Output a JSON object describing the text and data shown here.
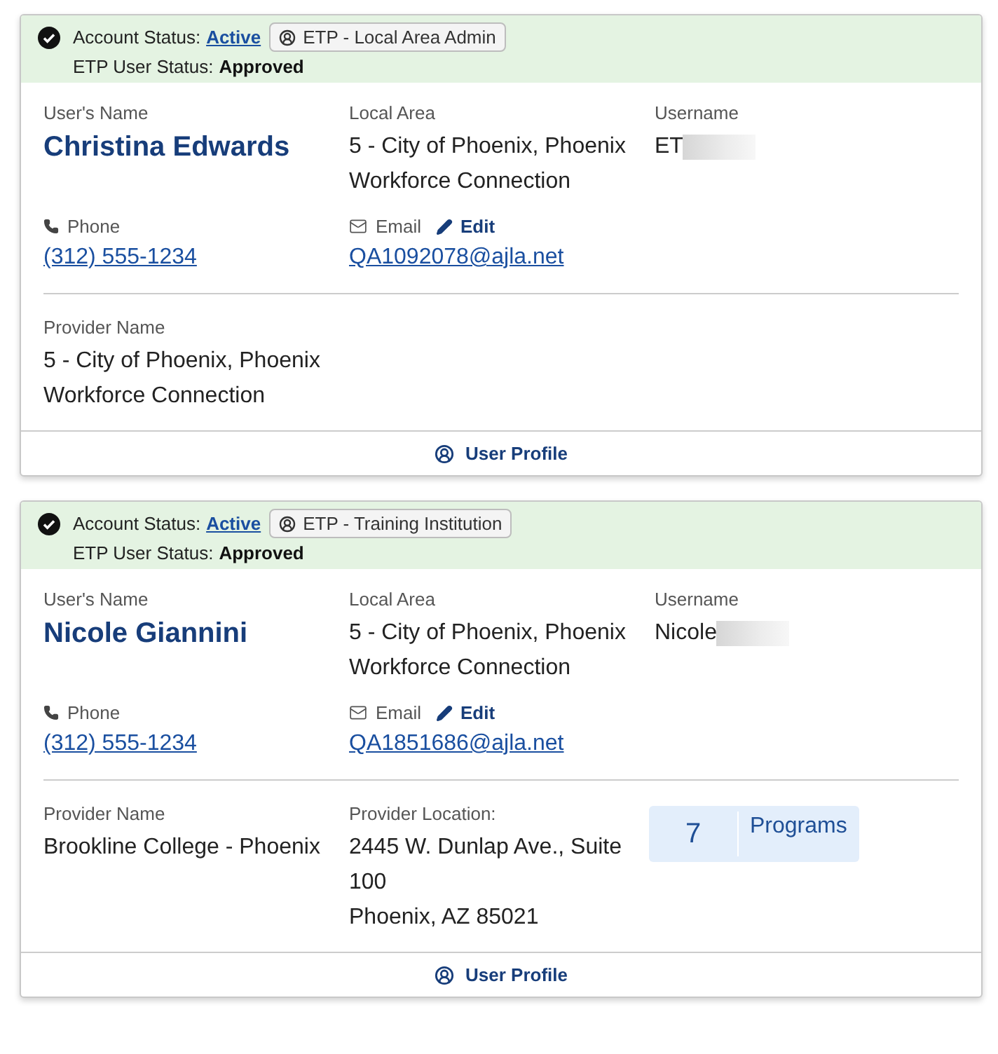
{
  "cards": [
    {
      "account_status_label": "Account Status:",
      "account_status": "Active",
      "role": "ETP - Local Area Admin",
      "user_status_label": "ETP User Status:",
      "user_status": "Approved",
      "name_label": "User's Name",
      "name": "Christina Edwards",
      "area_label": "Local Area",
      "area": "5 - City of Phoenix, Phoenix Workforce Connection",
      "username_label": "Username",
      "username": "ET",
      "phone_label": "Phone",
      "phone": "(312) 555-1234",
      "email_label": "Email",
      "edit": "Edit",
      "email": "QA1092078@ajla.net",
      "provider_label": "Provider Name",
      "provider": "5 - City of Phoenix, Phoenix Workforce Connection",
      "footer": "User Profile"
    },
    {
      "account_status_label": "Account Status:",
      "account_status": "Active",
      "role": "ETP - Training Institution",
      "user_status_label": "ETP User Status:",
      "user_status": "Approved",
      "name_label": "User's Name",
      "name": "Nicole Giannini",
      "area_label": "Local Area",
      "area": "5 - City of Phoenix, Phoenix Workforce Connection",
      "username_label": "Username",
      "username": "Nicole",
      "phone_label": "Phone",
      "phone": "(312) 555-1234",
      "email_label": "Email",
      "edit": "Edit",
      "email": "QA1851686@ajla.net",
      "provider_label": "Provider Name",
      "provider": "Brookline College - Phoenix",
      "location_label": "Provider Location:",
      "location_lines": [
        "2445 W. Dunlap Ave., Suite 100",
        "Phoenix, AZ 85021"
      ],
      "programs_count": "7",
      "programs_label": "Programs",
      "footer": "User Profile"
    }
  ]
}
